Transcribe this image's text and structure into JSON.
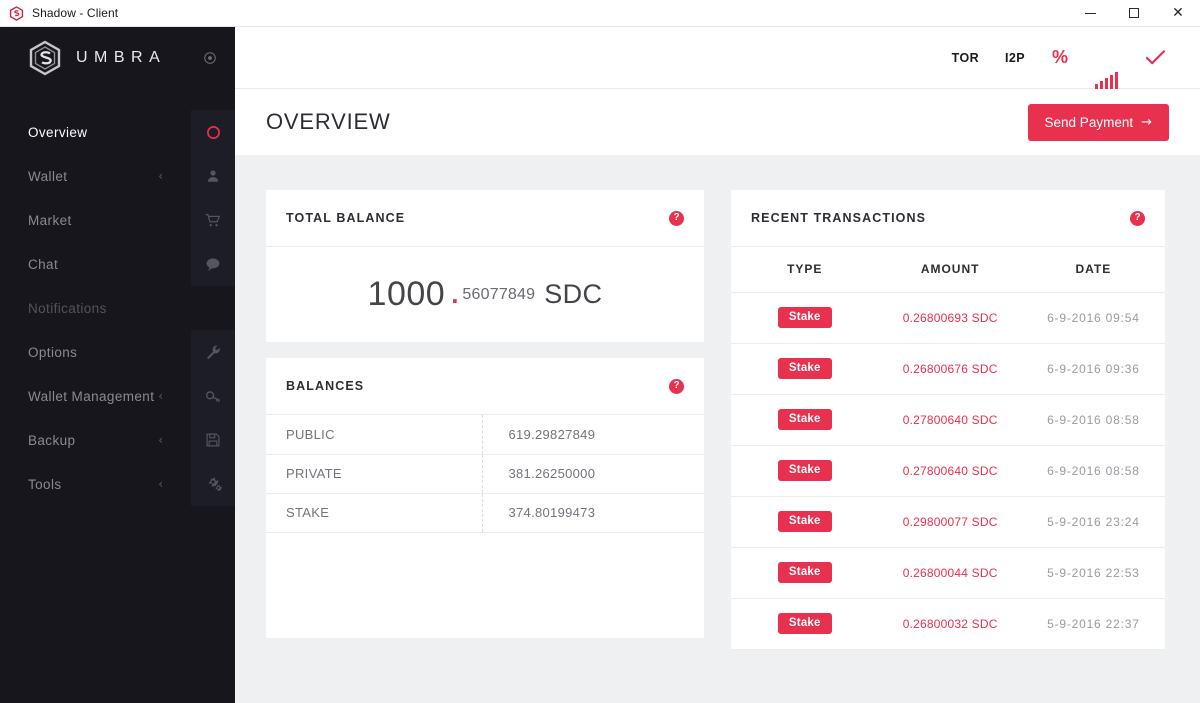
{
  "window": {
    "title": "Shadow - Client",
    "app_icon": "shadow-hexagon-icon",
    "minimize_label": "Minimize",
    "maximize_label": "Maximize",
    "close_label": "Close"
  },
  "sidebar": {
    "brand": "UMBRA",
    "brand_logo_icon": "umbra-hexagon-logo",
    "settings_icon": "target-gear-icon",
    "items": [
      {
        "label": "Overview",
        "icon": "circle-icon",
        "active": true,
        "muted": false,
        "chevron": "",
        "has_tile": true
      },
      {
        "label": "Wallet",
        "icon": "user-icon",
        "active": false,
        "muted": false,
        "chevron": "‹",
        "has_tile": true
      },
      {
        "label": "Market",
        "icon": "shopping-cart-icon",
        "active": false,
        "muted": false,
        "chevron": "",
        "has_tile": true
      },
      {
        "label": "Chat",
        "icon": "chat-bubble-icon",
        "active": false,
        "muted": false,
        "chevron": "",
        "has_tile": true
      },
      {
        "label": "Notifications",
        "icon": "",
        "active": false,
        "muted": true,
        "chevron": "",
        "has_tile": false
      },
      {
        "label": "Options",
        "icon": "wrench-icon",
        "active": false,
        "muted": false,
        "chevron": "",
        "has_tile": true
      },
      {
        "label": "Wallet Management",
        "icon": "key-icon",
        "active": false,
        "muted": false,
        "chevron": "‹",
        "has_tile": true
      },
      {
        "label": "Backup",
        "icon": "floppy-disk-icon",
        "active": false,
        "muted": false,
        "chevron": "‹",
        "has_tile": true
      },
      {
        "label": "Tools",
        "icon": "gears-icon",
        "active": false,
        "muted": false,
        "chevron": "‹",
        "has_tile": true
      }
    ]
  },
  "statusbar": {
    "tor_label": "TOR",
    "i2p_label": "I2P",
    "percent_label": "%",
    "signal_icon": "signal-bars-icon",
    "check_icon": "checkmark-icon"
  },
  "page": {
    "title": "OVERVIEW",
    "send_payment_label": "Send Payment",
    "send_payment_arrow": "→"
  },
  "total_balance": {
    "card_title": "TOTAL BALANCE",
    "help_icon": "help-question-icon",
    "help_glyph": "?",
    "integer": "1000",
    "separator": ".",
    "decimal": "56077849",
    "unit": "SDC"
  },
  "balances": {
    "card_title": "BALANCES",
    "help_icon": "help-question-icon",
    "help_glyph": "?",
    "rows": [
      {
        "label": "PUBLIC",
        "value": "619.29827849"
      },
      {
        "label": "PRIVATE",
        "value": "381.26250000"
      },
      {
        "label": "STAKE",
        "value": "374.80199473"
      }
    ]
  },
  "recent_transactions": {
    "card_title": "RECENT TRANSACTIONS",
    "help_icon": "help-question-icon",
    "help_glyph": "?",
    "columns": [
      "TYPE",
      "AMOUNT",
      "DATE"
    ],
    "rows": [
      {
        "type": "Stake",
        "amount": "0.26800693 SDC",
        "date": "6-9-2016 09:54"
      },
      {
        "type": "Stake",
        "amount": "0.26800676 SDC",
        "date": "6-9-2016 09:36"
      },
      {
        "type": "Stake",
        "amount": "0.27800640 SDC",
        "date": "6-9-2016 08:58"
      },
      {
        "type": "Stake",
        "amount": "0.27800640 SDC",
        "date": "6-9-2016 08:58"
      },
      {
        "type": "Stake",
        "amount": "0.29800077 SDC",
        "date": "5-9-2016 23:24"
      },
      {
        "type": "Stake",
        "amount": "0.26800044 SDC",
        "date": "5-9-2016 22:53"
      },
      {
        "type": "Stake",
        "amount": "0.26800032 SDC",
        "date": "5-9-2016 22:37"
      }
    ]
  },
  "colors": {
    "accent_red": "#e8304f",
    "sidebar_bg": "#16161c",
    "sidebar_tile": "#1d1d25",
    "content_bg": "#eff0f2",
    "card_bg": "#ffffff"
  }
}
